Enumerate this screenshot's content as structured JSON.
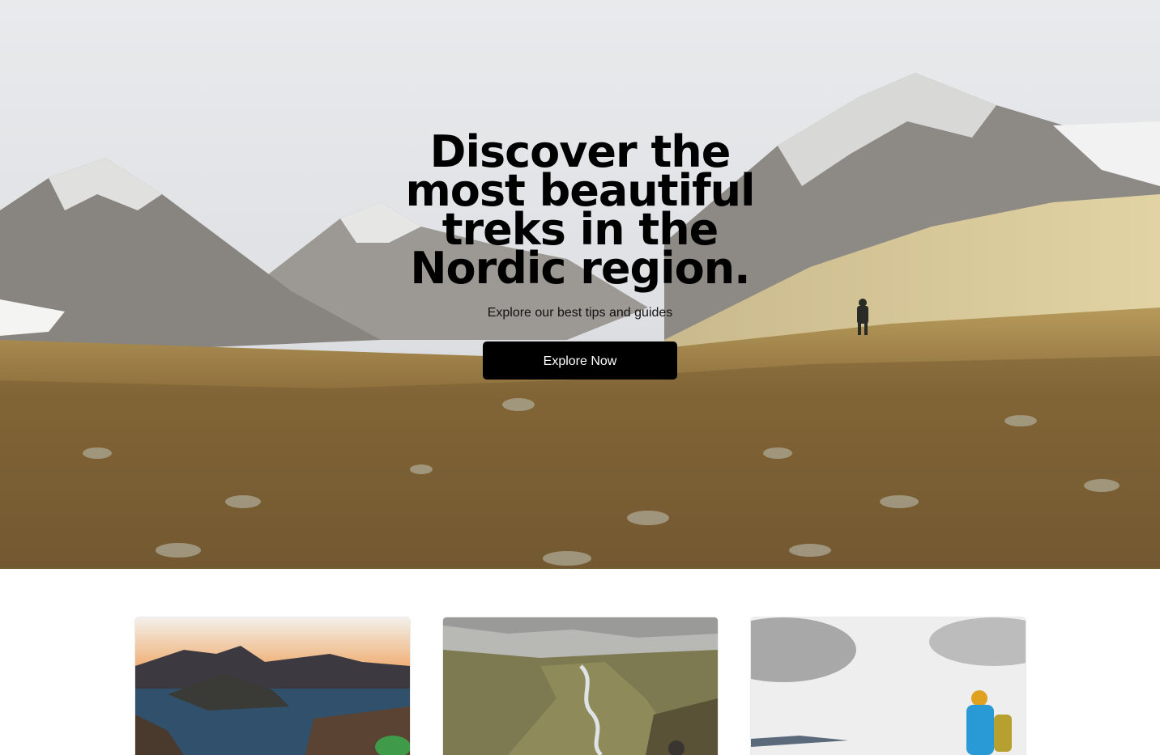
{
  "hero": {
    "title": "Discover the\nmost beautiful\ntreks in the\nNordic region.",
    "subtitle": "Explore our best tips and guides",
    "button_label": "Explore Now",
    "background_image": "mountain-valley-hiker-photo"
  },
  "cards": [
    {
      "image": "fjord-sunset-photo"
    },
    {
      "image": "river-valley-photo"
    },
    {
      "image": "hiker-cloudy-sky-photo"
    }
  ],
  "colors": {
    "button_bg": "#000000",
    "button_text": "#ffffff",
    "title_text": "#000000",
    "page_bg": "#ffffff"
  }
}
